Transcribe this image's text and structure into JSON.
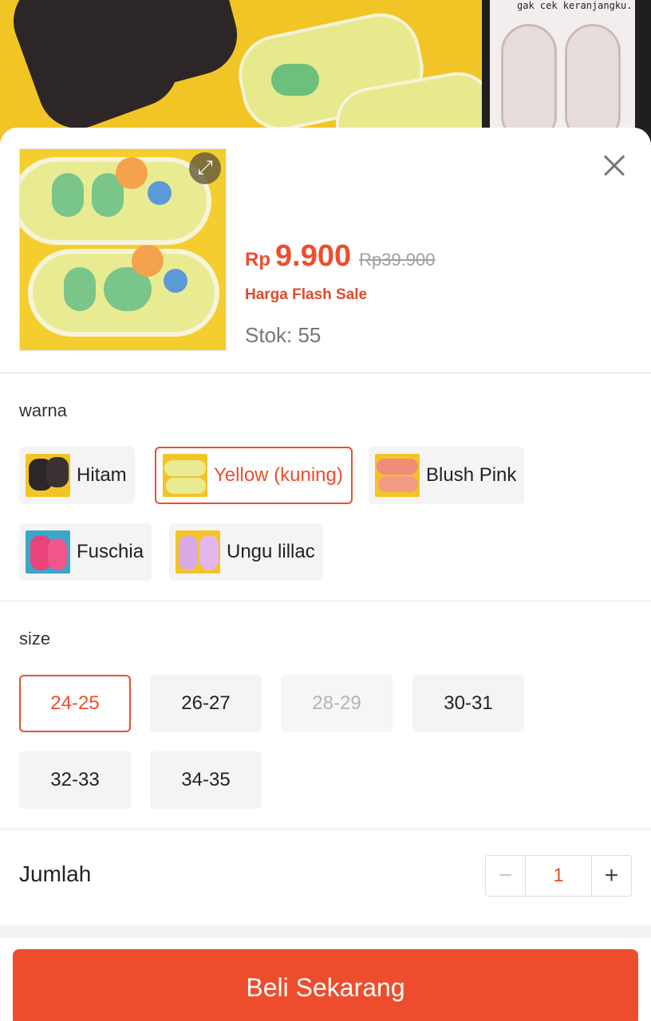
{
  "product": {
    "price_currency": "Rp",
    "price": "9.900",
    "original_price": "Rp39.900",
    "flash_sale_label": "Harga Flash Sale",
    "stock_text": "Stok: 55",
    "background_caption": "gak cek keranjangku."
  },
  "variants": {
    "title": "warna",
    "options": [
      {
        "label": "Hitam",
        "selected": false
      },
      {
        "label": "Yellow (kuning)",
        "selected": true
      },
      {
        "label": "Blush Pink",
        "selected": false
      },
      {
        "label": "Fuschia",
        "selected": false
      },
      {
        "label": "Ungu lillac",
        "selected": false
      }
    ]
  },
  "sizes": {
    "title": "size",
    "options": [
      {
        "label": "24-25",
        "state": "selected"
      },
      {
        "label": "26-27",
        "state": "available"
      },
      {
        "label": "28-29",
        "state": "disabled"
      },
      {
        "label": "30-31",
        "state": "available"
      },
      {
        "label": "32-33",
        "state": "available"
      },
      {
        "label": "34-35",
        "state": "available"
      }
    ]
  },
  "quantity": {
    "label": "Jumlah",
    "minus": "−",
    "value": "1",
    "plus": "+"
  },
  "buy_button": {
    "label": "Beli Sekarang"
  },
  "colors": {
    "accent": "#ee4d2d",
    "chip_bg": "#f4f4f4",
    "disabled_text": "#b5b5b5"
  }
}
